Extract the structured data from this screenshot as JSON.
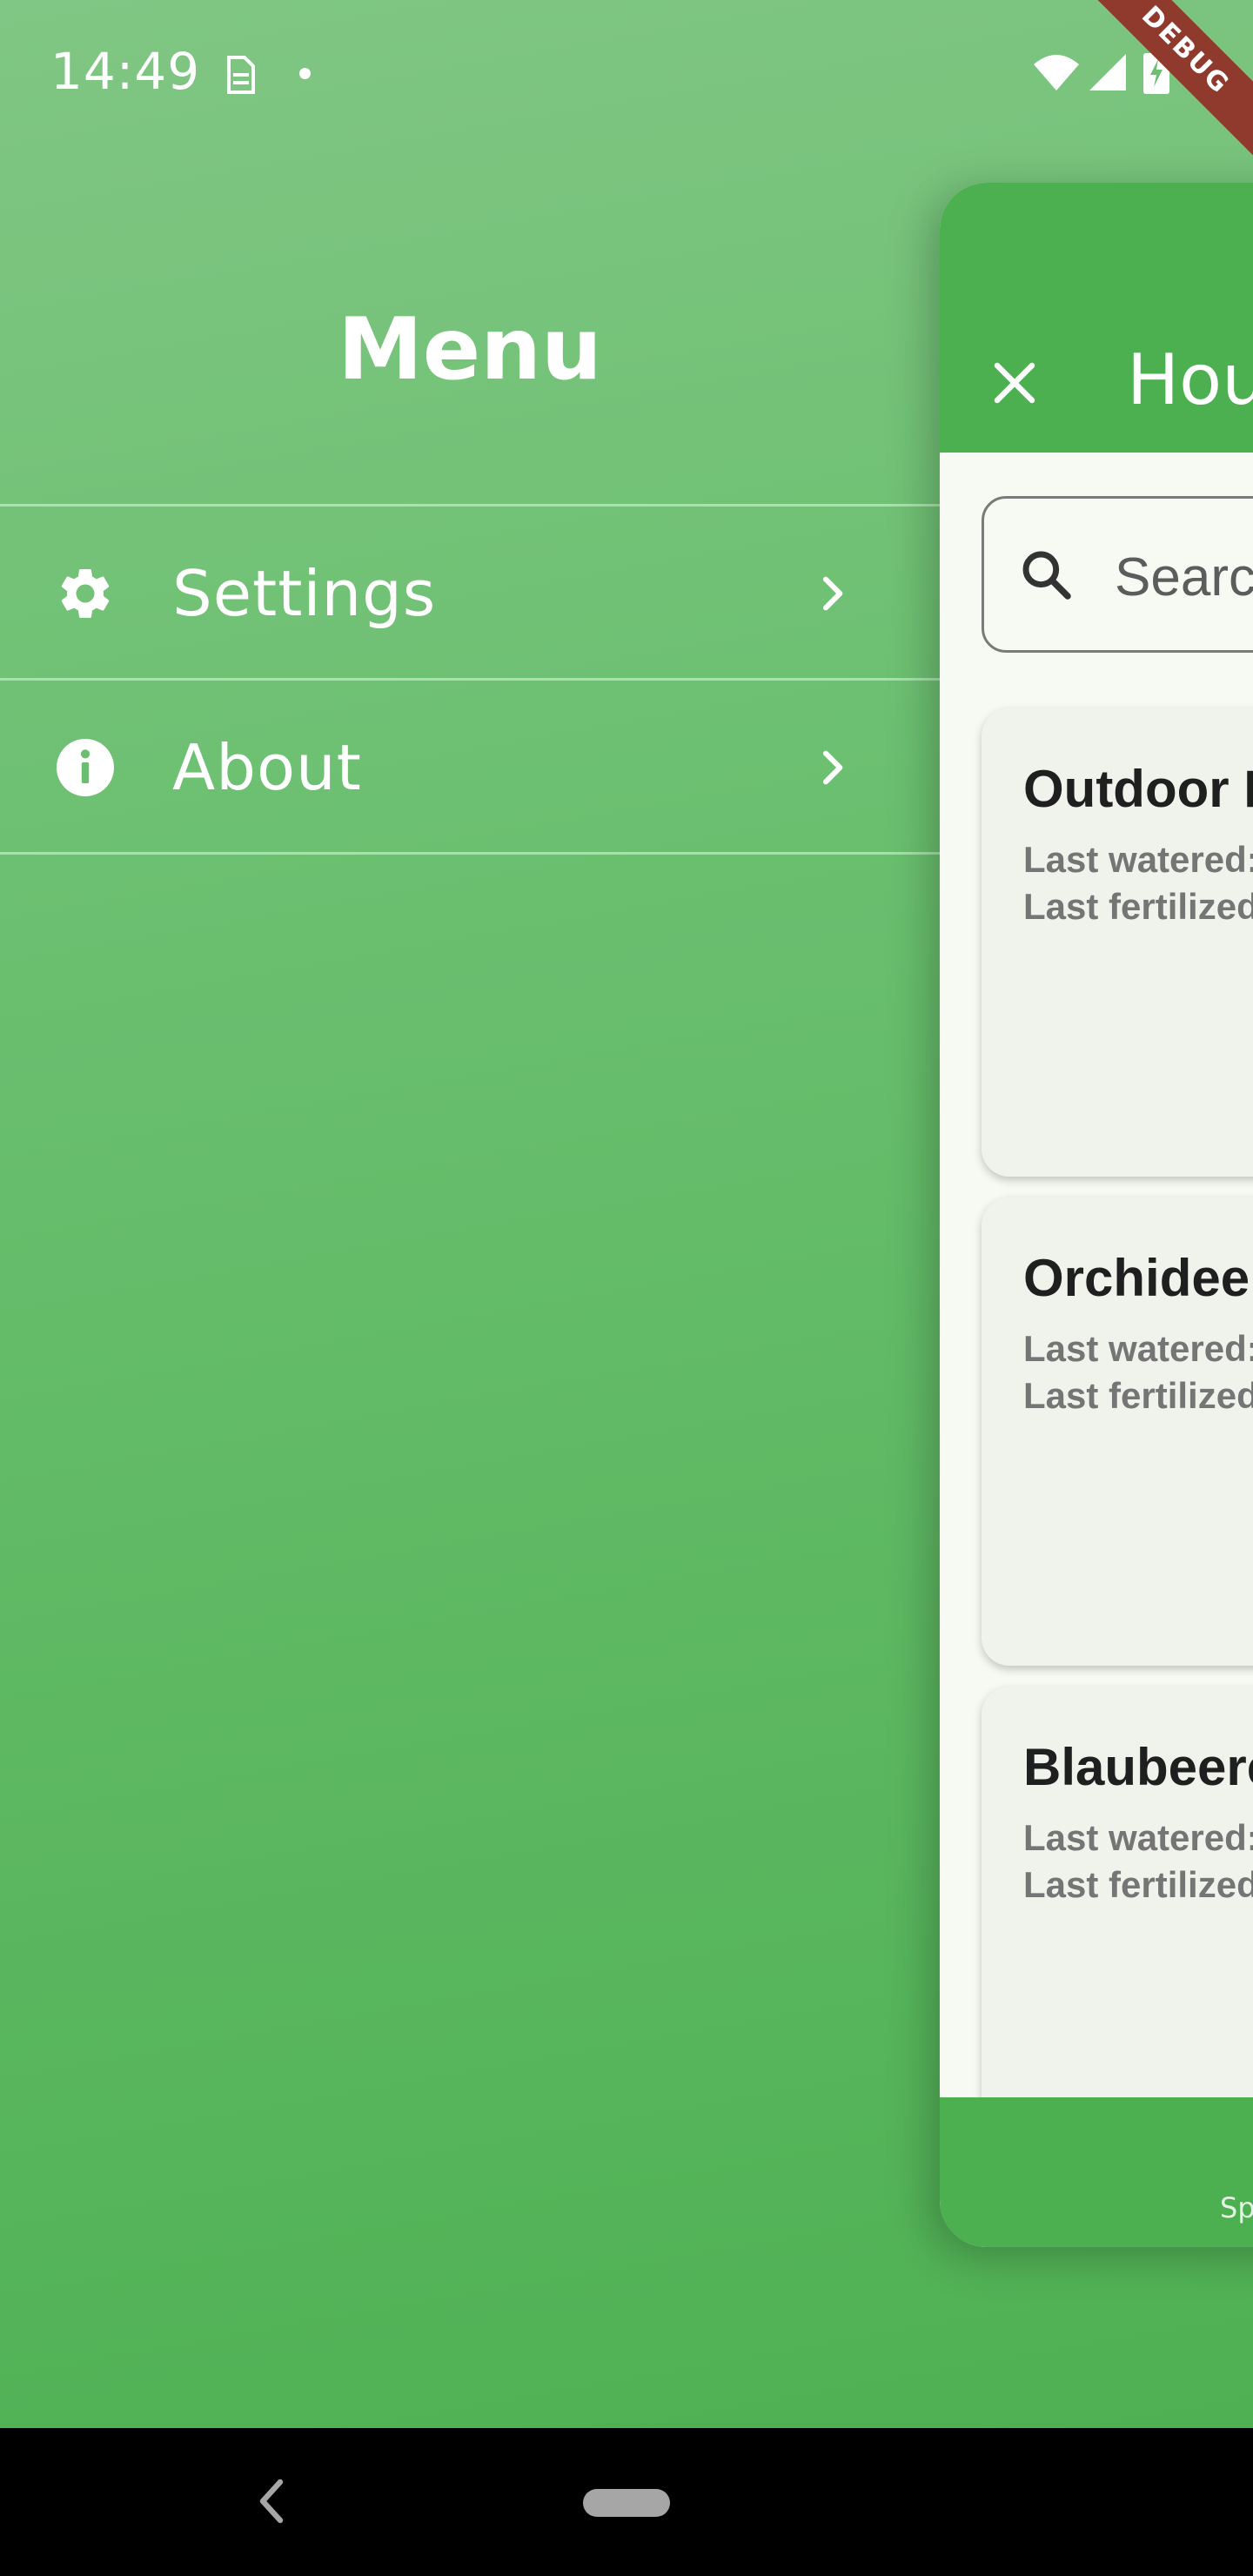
{
  "status_bar": {
    "time": "14:49",
    "icons": [
      "sim-card-icon",
      "notification-dot-icon",
      "wifi-icon",
      "cellular-signal-icon",
      "battery-charging-icon"
    ]
  },
  "debug_banner": "DEBUG",
  "drawer": {
    "title": "Menu",
    "items": [
      {
        "label": "Settings",
        "icon": "gear-icon"
      },
      {
        "label": "About",
        "icon": "info-icon"
      }
    ]
  },
  "app_preview": {
    "title": "Hou",
    "close_icon": "close-icon",
    "search": {
      "placeholder": "Searc",
      "value": ""
    },
    "plants": [
      {
        "name": "Outdoor F",
        "watered": "Last watered:",
        "fertilized": "Last fertilized"
      },
      {
        "name": "Orchideen",
        "watered": "Last watered:",
        "fertilized": "Last fertilized"
      },
      {
        "name": "Blaubeere",
        "watered": "Last watered:",
        "fertilized": "Last fertilized"
      }
    ],
    "bottom_nav": [
      {
        "label": "Sprouts",
        "icon": "leaf-icon"
      }
    ]
  },
  "colors": {
    "primary": "#4caf50",
    "drawer_background_top": "#80c684",
    "panel_background": "#f7f9f3",
    "card_background": "#f0f3ec",
    "debug_ribbon": "#8f3a2c"
  }
}
